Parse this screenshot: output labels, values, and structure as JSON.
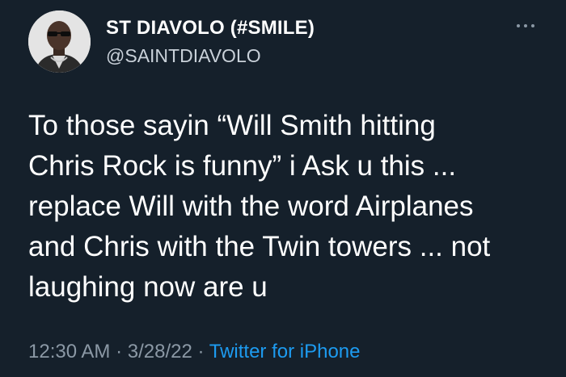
{
  "tweet": {
    "author": {
      "display_name": "ST DIAVOLO (#SMILE)",
      "handle": "@SAINTDIAVOLO"
    },
    "more_icon": "more-horizontal-icon",
    "text_lines": [
      "To those sayin “Will Smith hitting",
      "Chris Rock is funny” i Ask u this ...",
      "replace Will with the word Airplanes",
      "and Chris with the Twin towers ... not",
      "laughing now are u"
    ],
    "meta": {
      "time": "12:30 AM",
      "separator": "·",
      "date": "3/28/22",
      "source": "Twitter for iPhone"
    }
  },
  "colors": {
    "background": "#15202b",
    "text": "#ffffff",
    "secondary": "#8b98a5",
    "link": "#1d9bf0"
  }
}
